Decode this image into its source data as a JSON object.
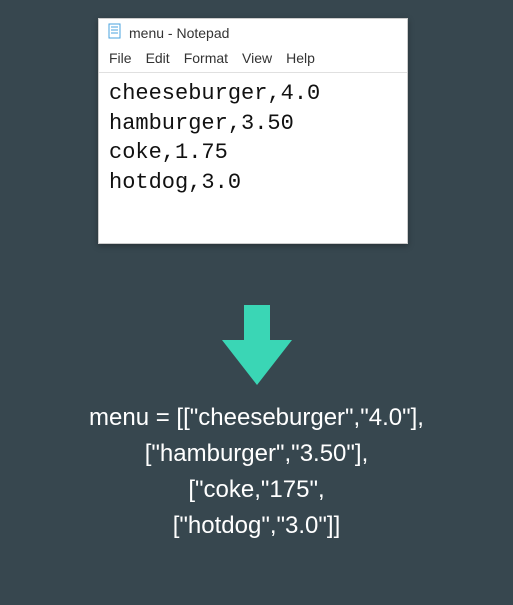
{
  "window": {
    "title": "menu - Notepad"
  },
  "menubar": {
    "file": "File",
    "edit": "Edit",
    "format": "Format",
    "view": "View",
    "help": "Help"
  },
  "editor": {
    "lines": [
      "cheeseburger,4.0",
      "hamburger,3.50",
      "coke,1.75",
      "hotdog,3.0"
    ]
  },
  "code": {
    "lines": [
      "menu = [[\"cheeseburger\",\"4.0\"],",
      "[\"hamburger\",\"3.50\"],",
      "[\"coke,\"175\",",
      "[\"hotdog\",\"3.0\"]]"
    ]
  },
  "colors": {
    "arrow": "#3ad6b5"
  }
}
